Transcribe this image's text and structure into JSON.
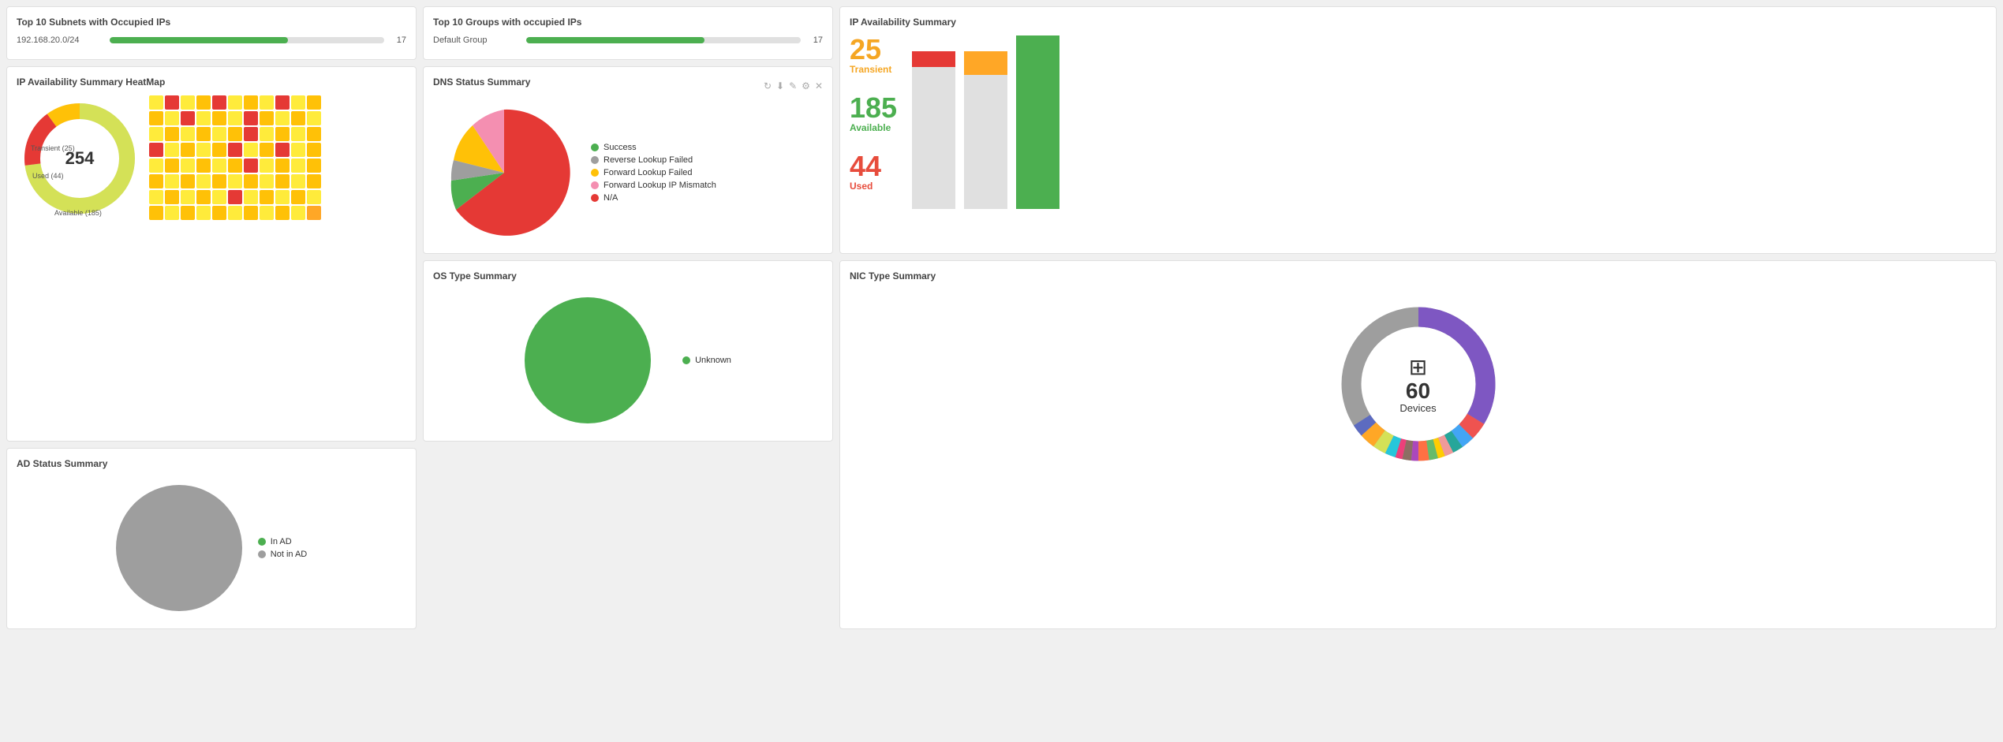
{
  "subnets": {
    "title": "Top 10 Subnets with Occupied IPs",
    "items": [
      {
        "label": "192.168.20.0/24",
        "value": 17,
        "pct": 65
      }
    ]
  },
  "groups": {
    "title": "Top 10 Groups with occupied IPs",
    "items": [
      {
        "label": "Default Group",
        "value": 17,
        "pct": 65
      }
    ]
  },
  "ip_avail_summary": {
    "title": "IP Availability Summary",
    "transient_num": "25",
    "transient_label": "Transient",
    "available_num": "185",
    "available_label": "Available",
    "used_num": "44",
    "used_label": "Used"
  },
  "heatmap": {
    "title": "IP Availability Summary HeatMap",
    "legend": [
      {
        "label": "Available (185)",
        "color": "#c8e6c9"
      },
      {
        "label": "Used (44)",
        "color": "#e53935"
      },
      {
        "label": "Transient (25)",
        "color": "#ffc107"
      }
    ],
    "center_value": "254"
  },
  "dns": {
    "title": "DNS Status Summary",
    "legend": [
      {
        "label": "Success",
        "color": "#4caf50"
      },
      {
        "label": "Reverse Lookup Failed",
        "color": "#9e9e9e"
      },
      {
        "label": "Forward Lookup Failed",
        "color": "#ffc107"
      },
      {
        "label": "Forward Lookup IP Mismatch",
        "color": "#f48fb1"
      },
      {
        "label": "N/A",
        "color": "#e53935"
      }
    ]
  },
  "os": {
    "title": "OS Type Summary",
    "legend": [
      {
        "label": "Unknown",
        "color": "#4caf50"
      }
    ]
  },
  "ad": {
    "title": "AD Status Summary",
    "legend": [
      {
        "label": "In AD",
        "color": "#4caf50"
      },
      {
        "label": "Not in AD",
        "color": "#9e9e9e"
      }
    ]
  },
  "nic": {
    "title": "NIC Type Summary",
    "devices_num": "60",
    "devices_label": "Devices"
  }
}
